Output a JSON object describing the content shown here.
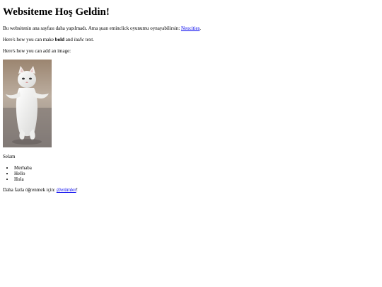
{
  "header": {
    "title": "Websiteme Hoş Geldin!"
  },
  "intro": {
    "text": "Bu websitenin ana sayfası daha yapılmadı. Ama şuan eminclick oyunumu oynayabilirsin: ",
    "link_label": "Neocities",
    "end": "."
  },
  "formatting": {
    "prefix": "Here's how you can make ",
    "bold": "bold",
    "middle": " and ",
    "italic": "italic",
    "suffix": " text."
  },
  "image_section": {
    "text": "Here's how you can add an image:",
    "image_icon": "white-cat-standing-image"
  },
  "greeting": {
    "text": "Selam"
  },
  "list": {
    "items": [
      "Merhaba",
      "Hello",
      "Hola"
    ]
  },
  "footer": {
    "prefix": "Daha fazla öğrenmek için: ",
    "link_label": "@etümler",
    "suffix": "!"
  },
  "colors": {
    "link": "#0000ee",
    "text": "#000000",
    "background": "#ffffff"
  }
}
